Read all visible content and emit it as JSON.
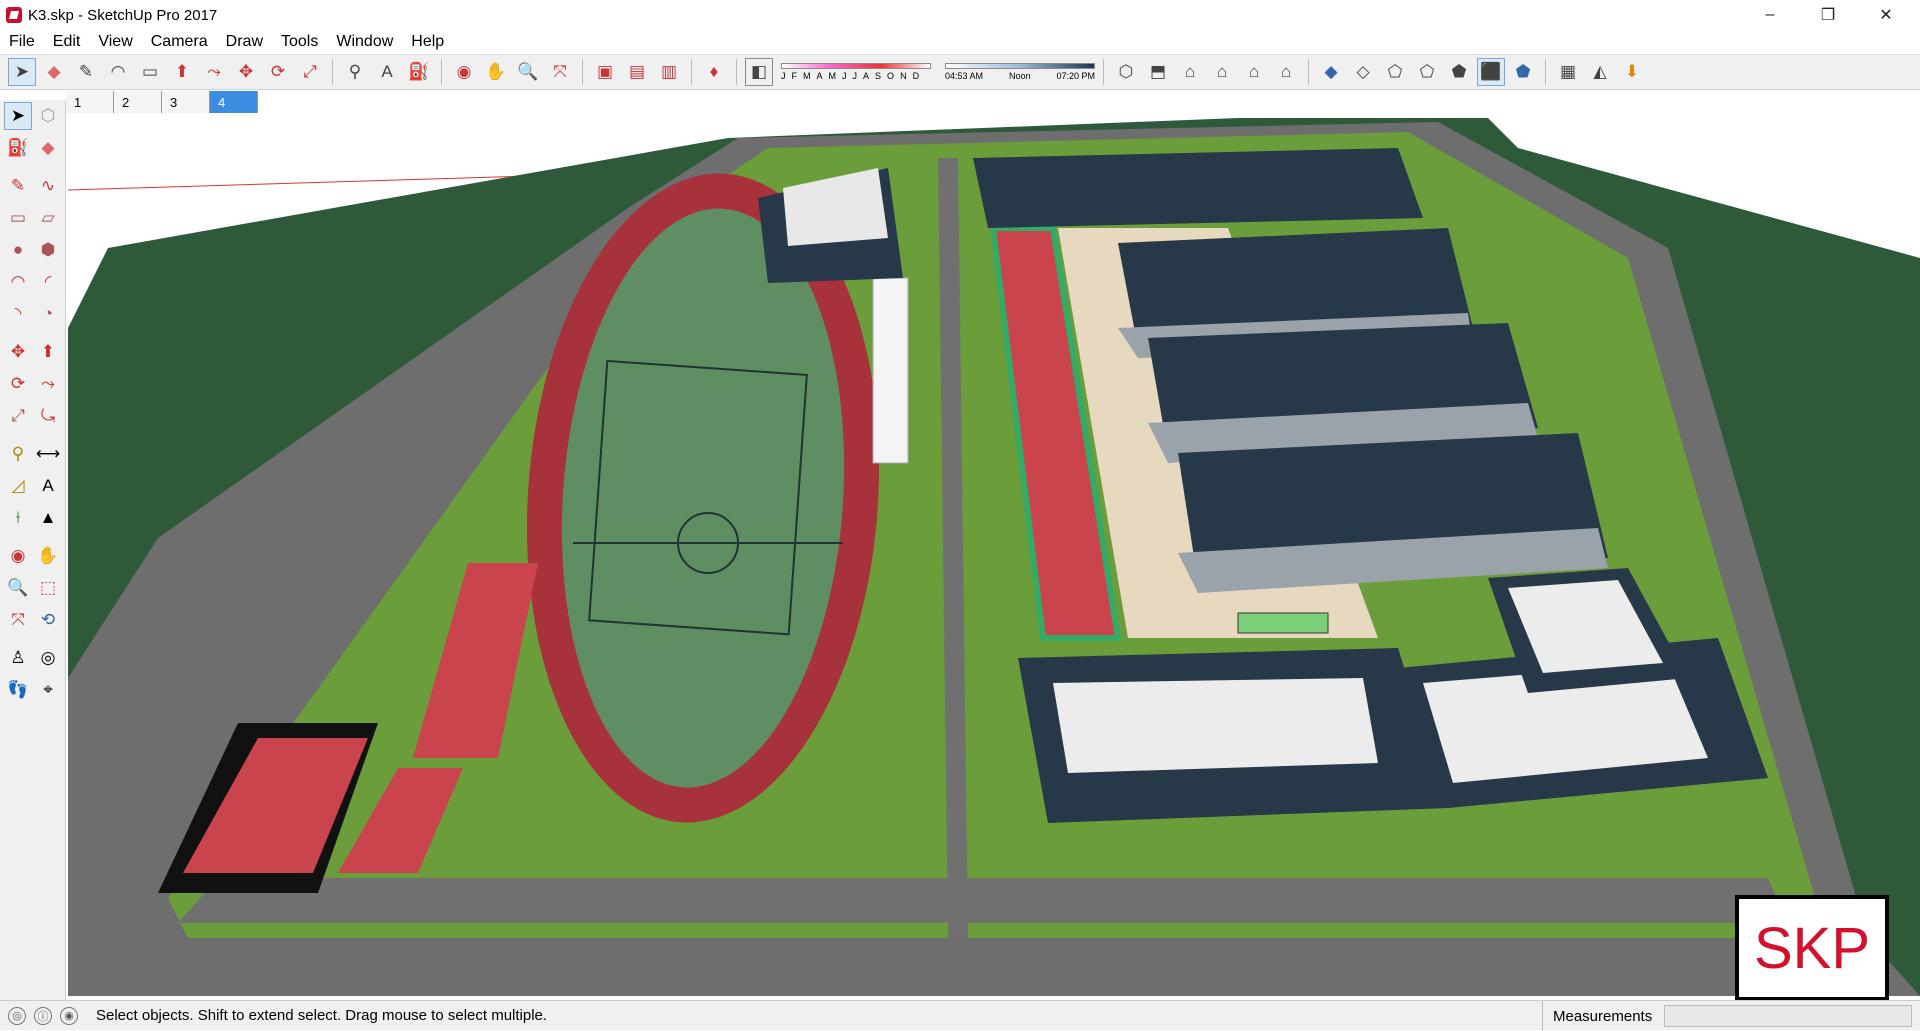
{
  "window": {
    "title": "K3.skp - SketchUp Pro 2017",
    "minimize_glyph": "–",
    "maximize_glyph": "❐",
    "close_glyph": "✕"
  },
  "menu": {
    "items": [
      "File",
      "Edit",
      "View",
      "Camera",
      "Draw",
      "Tools",
      "Window",
      "Help"
    ]
  },
  "shadows": {
    "months": [
      "J",
      "F",
      "M",
      "A",
      "M",
      "J",
      "J",
      "A",
      "S",
      "O",
      "N",
      "D"
    ],
    "time_start": "04:53 AM",
    "time_mid": "Noon",
    "time_end": "07:20 PM"
  },
  "scenes": {
    "tabs": [
      "1",
      "2",
      "3",
      "4"
    ],
    "active_index": 3
  },
  "status": {
    "message": "Select objects. Shift to extend select. Drag mouse to select multiple.",
    "measurements_label": "Measurements",
    "measurements_value": ""
  },
  "watermark": {
    "text": "SKP"
  },
  "colors": {
    "grass": "#6b9e3a",
    "road": "#6e6e6e",
    "dark_field": "#2f5a3a",
    "track": "#a8323c",
    "pitch": "#5f8e62",
    "roof": "#273848",
    "accent": "#d3112d"
  }
}
